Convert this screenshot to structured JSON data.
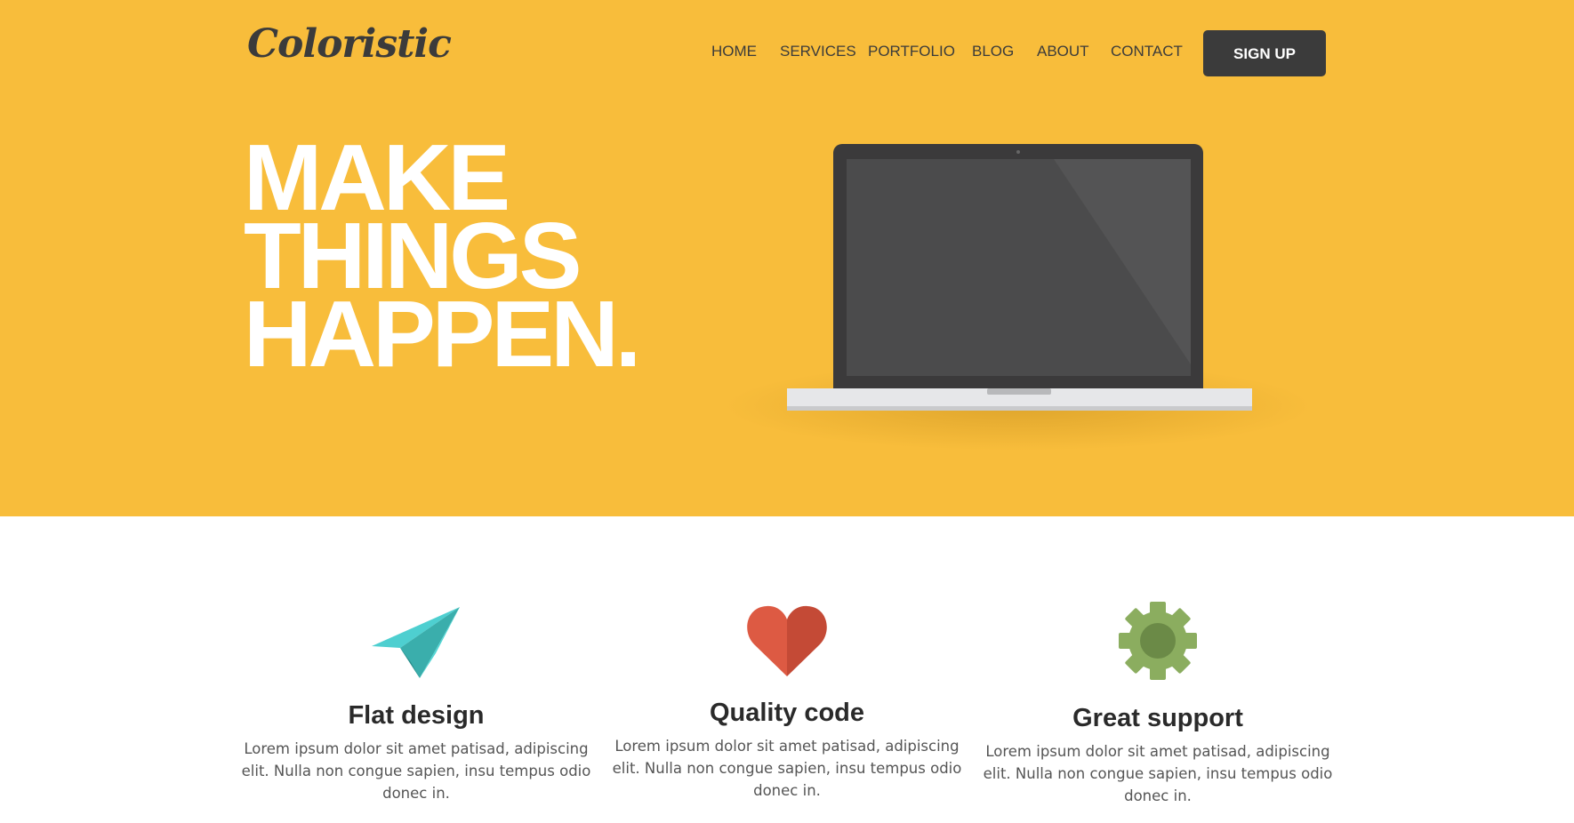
{
  "header": {
    "logo": "Coloristic",
    "nav": [
      "HOME",
      "SERVICES",
      "PORTFOLIO",
      "BLOG",
      "ABOUT",
      "CONTACT"
    ],
    "signup_label": "SIGN UP"
  },
  "hero": {
    "headline": [
      "MAKE",
      "THINGS",
      "HAPPEN."
    ],
    "background_color": "#f8bd3b",
    "image": "laptop-illustration"
  },
  "features": [
    {
      "icon": "paper-plane-icon",
      "title": "Flat design",
      "text": "Lorem ipsum dolor sit amet patisad, adipiscing elit. Nulla non congue sapien, insu tempus odio donec in."
    },
    {
      "icon": "heart-icon",
      "title": "Quality code",
      "text": "Lorem ipsum dolor sit amet patisad, adipiscing elit. Nulla non congue sapien, insu tempus odio donec in."
    },
    {
      "icon": "gear-icon",
      "title": "Great support",
      "text": "Lorem ipsum dolor sit amet patisad, adipiscing elit. Nulla non congue sapien, insu tempus odio donec in."
    }
  ],
  "colors": {
    "accent": "#f8bd3b",
    "dark": "#3b3b3b",
    "plane": "#4ecfd0",
    "heart": "#dd5a43",
    "gear": "#8bad5f"
  }
}
